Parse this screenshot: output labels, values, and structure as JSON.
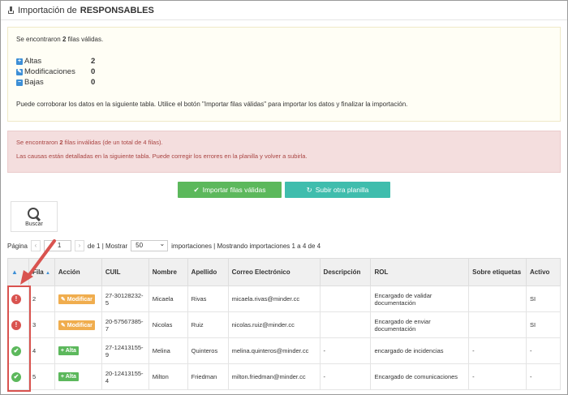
{
  "header": {
    "title_prefix": "Importación de ",
    "title_bold": "RESPONSABLES"
  },
  "info": {
    "valid_pre": "Se encontraron ",
    "valid_count": "2",
    "valid_post": " filas válidas.",
    "stats": [
      {
        "label": "Altas",
        "value": "2",
        "icon": "+"
      },
      {
        "label": "Modificaciones",
        "value": "0",
        "icon": "✎"
      },
      {
        "label": "Bajas",
        "value": "0",
        "icon": "−"
      }
    ],
    "footer": "Puede corroborar los datos en la siguiente tabla. Utilice el botón \"Importar filas válidas\" para importar los datos y finalizar la importación."
  },
  "error": {
    "line1_pre": "Se encontraron ",
    "line1_count": "2",
    "line1_post": " filas inválidas (de un total de 4 filas).",
    "line2": "Las causas están detalladas en la siguiente tabla. Puede corregir los errores en la planilla y volver a subirla."
  },
  "buttons": {
    "import": "Importar filas válidas",
    "upload": "Subir otra planilla"
  },
  "search": {
    "label": "Buscar"
  },
  "pager": {
    "page_label": "Página",
    "page_value": "1",
    "of_text": "de 1 | Mostrar",
    "per_page": "50",
    "summary": "importaciones | Mostrando importaciones 1 a 4 de 4"
  },
  "table": {
    "headers": [
      "",
      "Fila",
      "Acción",
      "CUIL",
      "Nombre",
      "Apellido",
      "Correo Electrónico",
      "Descripción",
      "ROL",
      "Sobre etiquetas",
      "Activo"
    ],
    "rows": [
      {
        "status": "warn",
        "fila": "2",
        "accion": "Modificar",
        "cuil": "27-30128232-5",
        "nombre": "Micaela",
        "apellido": "Rivas",
        "correo": "micaela.rivas@minder.cc",
        "descripcion": "",
        "rol": "Encargado de validar documentación",
        "sobre": "",
        "activo": "SI"
      },
      {
        "status": "warn",
        "fila": "3",
        "accion": "Modificar",
        "cuil": "20-57567385-7",
        "nombre": "Nicolas",
        "apellido": "Ruiz",
        "correo": "nicolas.ruiz@minder.cc",
        "descripcion": "",
        "rol": "Encargado de enviar documentación",
        "sobre": "",
        "activo": "SI"
      },
      {
        "status": "ok",
        "fila": "4",
        "accion": "Alta",
        "cuil": "27-12413155-9",
        "nombre": "Melina",
        "apellido": "Quinteros",
        "correo": "melina.quinteros@minder.cc",
        "descripcion": "-",
        "rol": "encargado de incidencias",
        "sobre": "-",
        "activo": "-"
      },
      {
        "status": "ok",
        "fila": "5",
        "accion": "Alta",
        "cuil": "20-12413155-4",
        "nombre": "Milton",
        "apellido": "Friedman",
        "correo": "milton.friedman@minder.cc",
        "descripcion": "-",
        "rol": "Encargado de comunicaciones",
        "sobre": "-",
        "activo": "-"
      }
    ]
  },
  "colors": {
    "accent_green": "#5cb85c",
    "accent_teal": "#3fbdad",
    "warning_red": "#d9534f",
    "badge_orange": "#f0ad4e",
    "info_blue": "#3d8fd6"
  }
}
